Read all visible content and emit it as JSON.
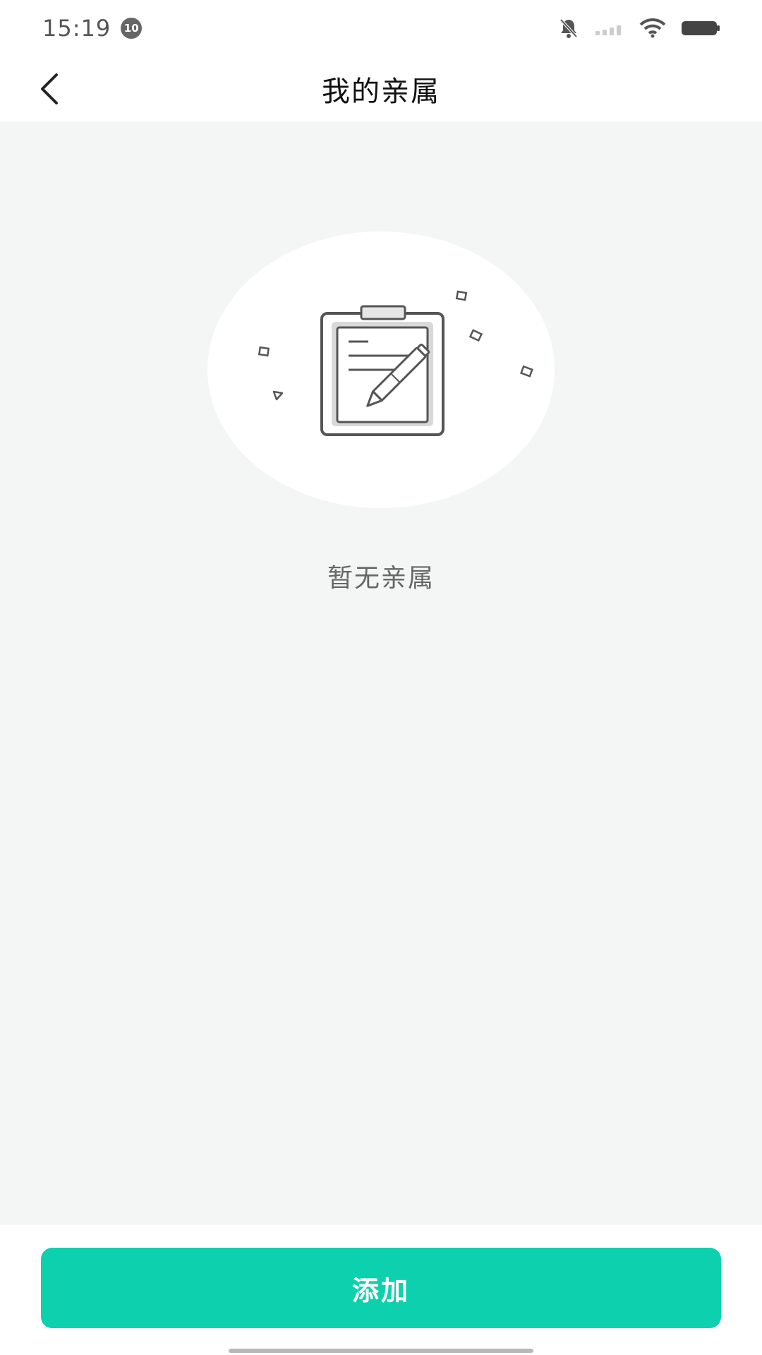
{
  "status_bar": {
    "time": "15:19",
    "notification_badge": "10"
  },
  "header": {
    "title": "我的亲属",
    "back_icon": "chevron-left-icon"
  },
  "empty_state": {
    "message": "暂无亲属",
    "illustration_icon": "clipboard-pen-icon"
  },
  "footer": {
    "add_label": "添加"
  },
  "colors": {
    "accent": "#0dd1ae",
    "background": "#f4f5f5",
    "header_background": "#ffffff"
  }
}
